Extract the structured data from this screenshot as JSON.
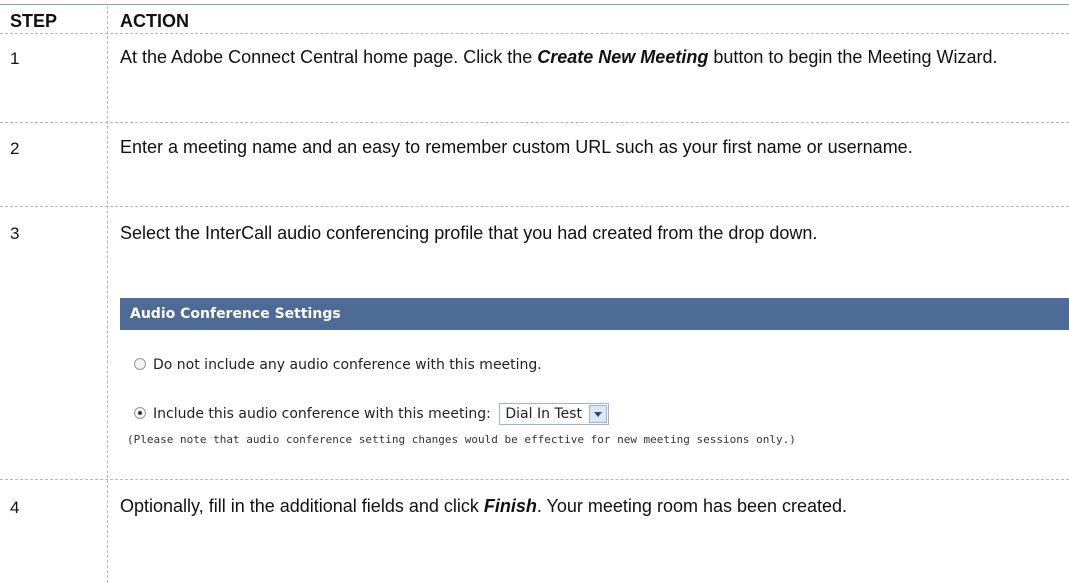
{
  "table": {
    "header": {
      "step": "STEP",
      "action": "ACTION"
    },
    "rows": [
      {
        "step": "1",
        "pre": "At the Adobe Connect Central home page. Click the ",
        "em": "Create New Meeting",
        "post": " button to begin the Meeting Wizard."
      },
      {
        "step": "2",
        "text": "Enter a meeting name and an easy to remember custom URL such as your first name or username."
      },
      {
        "step": "3",
        "text": "Select the InterCall audio conferencing profile that you had created from the drop down."
      },
      {
        "step": "4",
        "pre": "Optionally, fill in the additional fields and click ",
        "em": "Finish",
        "post": ". Your meeting room has been created."
      }
    ]
  },
  "audio_panel": {
    "title": "Audio Conference Settings",
    "option_none": "Do not include any audio conference with this meeting.",
    "option_include": "Include this audio conference with this meeting:",
    "selected_profile": "Dial In Test",
    "selected_option": "include",
    "note": "(Please note that audio conference setting changes would be effective for new meeting sessions only.)"
  }
}
